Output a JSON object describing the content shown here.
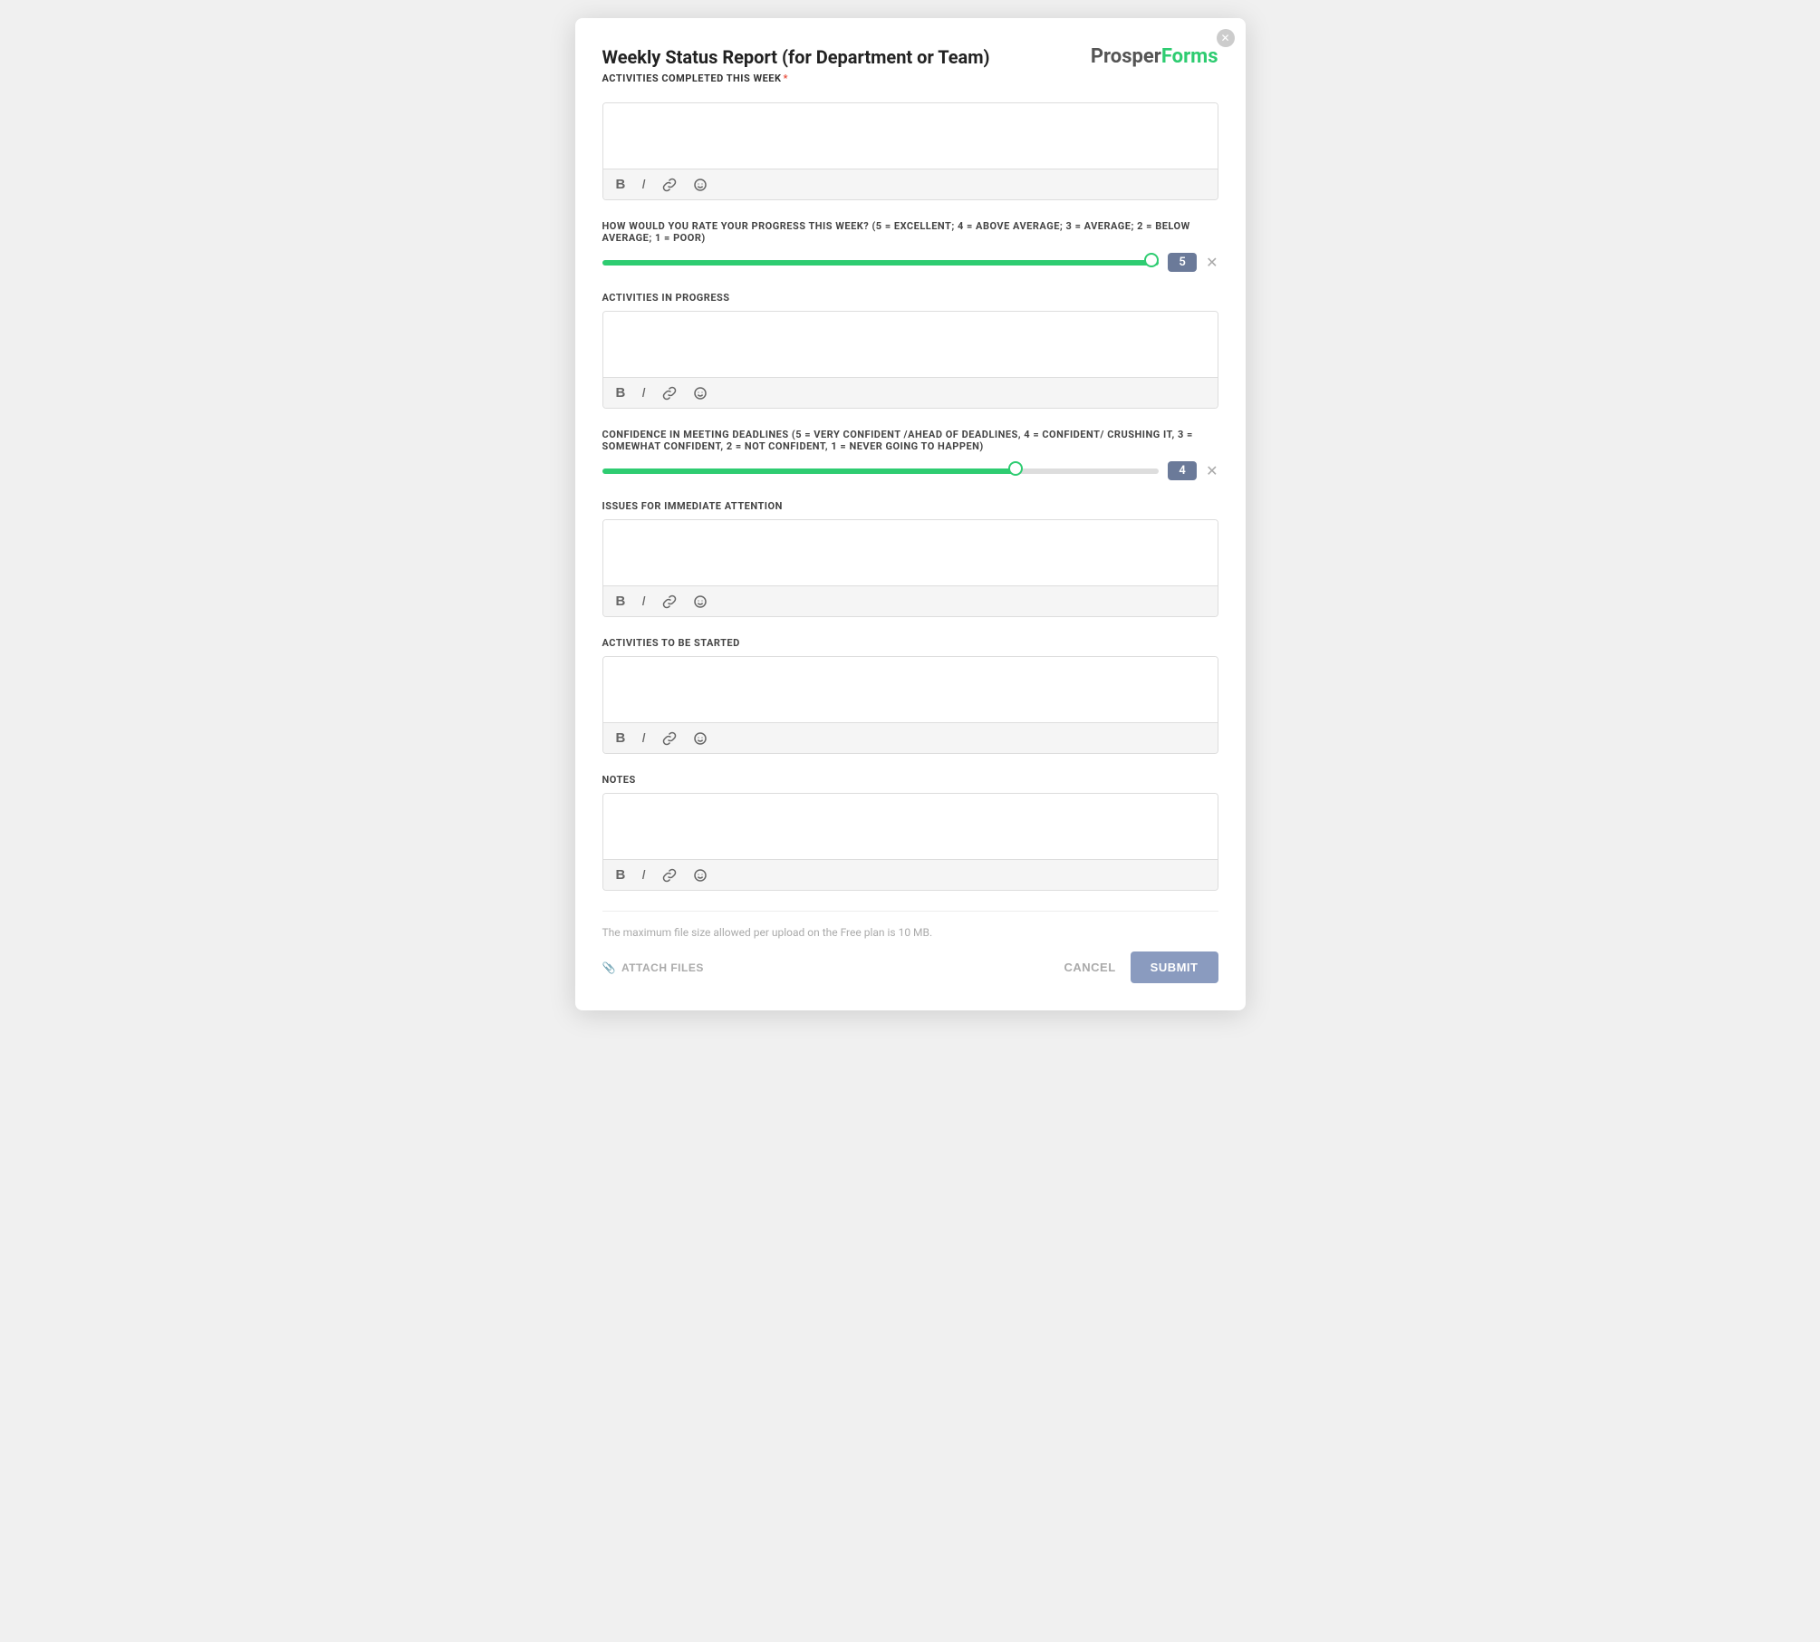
{
  "header": {
    "title": "Weekly Status Report (for Department or Team)",
    "subtitle": "ACTIVITIES COMPLETED THIS WEEK",
    "required": true,
    "brand": {
      "prosper": "Prosper",
      "forms": "Forms"
    }
  },
  "fields": {
    "activities_completed": {
      "label": "ACTIVITIES COMPLETED THIS WEEK",
      "required": true,
      "placeholder": "",
      "toolbar": {
        "bold": "B",
        "italic": "I"
      }
    },
    "progress_rating": {
      "label": "HOW WOULD YOU RATE YOUR PROGRESS THIS WEEK? (5 = EXCELLENT; 4 = ABOVE AVERAGE; 3 = AVERAGE; 2 = BELOW AVERAGE; 1 = POOR)",
      "value": 5,
      "min": 1,
      "max": 5,
      "fill_percent": 100
    },
    "activities_in_progress": {
      "label": "ACTIVITIES IN PROGRESS",
      "required": false,
      "placeholder": ""
    },
    "confidence_deadlines": {
      "label": "CONFIDENCE IN MEETING DEADLINES (5 = VERY CONFIDENT /AHEAD OF DEADLINES, 4 = CONFIDENT/ CRUSHING IT, 3 = SOMEWHAT CONFIDENT, 2 = NOT CONFIDENT, 1 = NEVER GOING TO HAPPEN)",
      "value": 4,
      "min": 1,
      "max": 5,
      "fill_percent": 75
    },
    "issues_attention": {
      "label": "ISSUES FOR IMMEDIATE ATTENTION",
      "required": false,
      "placeholder": ""
    },
    "activities_to_start": {
      "label": "ACTIVITIES TO BE STARTED",
      "required": false,
      "placeholder": ""
    },
    "notes": {
      "label": "NOTES",
      "required": false,
      "placeholder": ""
    }
  },
  "footer": {
    "file_size_note": "The maximum file size allowed per upload on the Free plan is 10 MB.",
    "attach_label": "ATTACH FILES",
    "cancel_label": "CANCEL",
    "submit_label": "SUBMIT"
  }
}
